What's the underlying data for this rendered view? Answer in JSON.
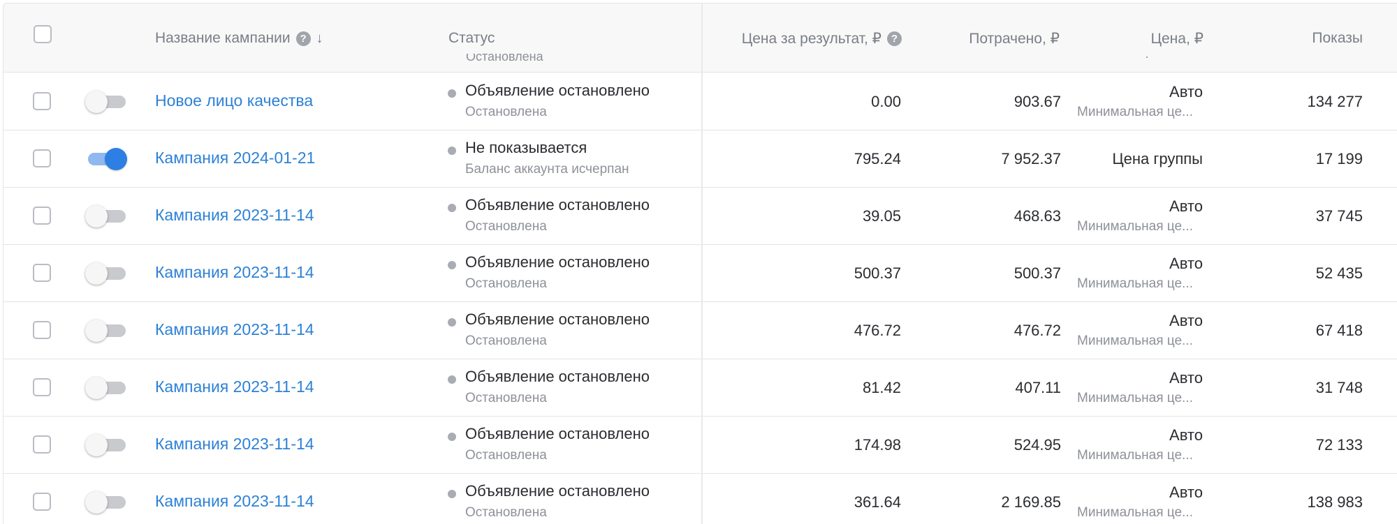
{
  "header": {
    "name": "Название кампании",
    "status": "Статус",
    "cpr": "Цена за результат, ₽",
    "spent": "Потрачено, ₽",
    "price": "Цена, ₽",
    "impressions": "Показы"
  },
  "peek": {
    "status_sub": "Остановлена",
    "price_sub": "Минимальная це..."
  },
  "rows": [
    {
      "toggle_on": false,
      "name": "Новое лицо качества",
      "status": "Объявление остановлено",
      "status_sub": "Остановлена",
      "cpr": "0.00",
      "spent": "903.67",
      "price": "Авто",
      "price_sub": "Минимальная це...",
      "impressions": "134 277"
    },
    {
      "toggle_on": true,
      "name": "Кампания 2024-01-21",
      "status": "Не показывается",
      "status_sub": "Баланс аккаунта исчерпан",
      "cpr": "795.24",
      "spent": "7 952.37",
      "price": "Цена группы",
      "price_sub": "",
      "impressions": "17 199"
    },
    {
      "toggle_on": false,
      "name": "Кампания 2023-11-14",
      "status": "Объявление остановлено",
      "status_sub": "Остановлена",
      "cpr": "39.05",
      "spent": "468.63",
      "price": "Авто",
      "price_sub": "Минимальная це...",
      "impressions": "37 745"
    },
    {
      "toggle_on": false,
      "name": "Кампания 2023-11-14",
      "status": "Объявление остановлено",
      "status_sub": "Остановлена",
      "cpr": "500.37",
      "spent": "500.37",
      "price": "Авто",
      "price_sub": "Минимальная це...",
      "impressions": "52 435"
    },
    {
      "toggle_on": false,
      "name": "Кампания 2023-11-14",
      "status": "Объявление остановлено",
      "status_sub": "Остановлена",
      "cpr": "476.72",
      "spent": "476.72",
      "price": "Авто",
      "price_sub": "Минимальная це...",
      "impressions": "67 418"
    },
    {
      "toggle_on": false,
      "name": "Кампания 2023-11-14",
      "status": "Объявление остановлено",
      "status_sub": "Остановлена",
      "cpr": "81.42",
      "spent": "407.11",
      "price": "Авто",
      "price_sub": "Минимальная це...",
      "impressions": "31 748"
    },
    {
      "toggle_on": false,
      "name": "Кампания 2023-11-14",
      "status": "Объявление остановлено",
      "status_sub": "Остановлена",
      "cpr": "174.98",
      "spent": "524.95",
      "price": "Авто",
      "price_sub": "Минимальная це...",
      "impressions": "72 133"
    },
    {
      "toggle_on": false,
      "name": "Кампания 2023-11-14",
      "status": "Объявление остановлено",
      "status_sub": "Остановлена",
      "cpr": "361.64",
      "spent": "2 169.85",
      "price": "Авто",
      "price_sub": "Минимальная це...",
      "impressions": "138 983"
    }
  ]
}
